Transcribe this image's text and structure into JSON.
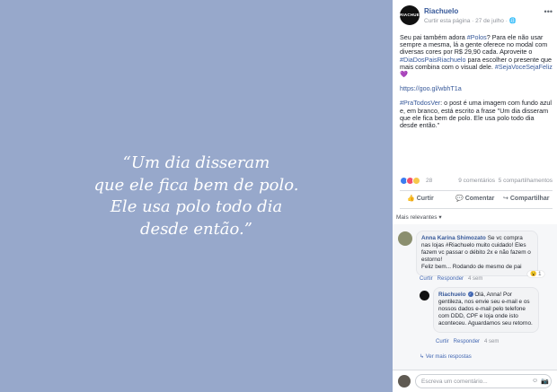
{
  "image": {
    "quote_lines": [
      "“Um dia disseram",
      "que ele fica bem de polo.",
      "Ele usa polo todo dia",
      "desde então.”"
    ]
  },
  "post": {
    "page_logo_text": "RIACHUELO",
    "page_name": "Riachuelo",
    "subline_follow": "Curtir esta página",
    "subline_date": "27 de julho",
    "audience_icon": "globe-icon",
    "more_icon": "more-dots-icon",
    "text_p1_a": "Seu pai também adora ",
    "text_p1_tag1": "#Polos",
    "text_p1_b": "? Para ele não usar sempre a mesma, lá a gente oferece no modal com diversas cores por R$ 29,90 cada. Aproveite o ",
    "text_p1_tag2": "#DiaDosPaisRiachuelo",
    "text_p1_c": " para escolher o presente que mais combina com o visual dele. ",
    "text_p1_tag3": "#SejaVoceSejaFeliz",
    "text_p1_heart": " 💜",
    "text_link": "https://goo.gl/wbhT1a",
    "text_p3_tag": "#PraTodosVer",
    "text_p3": ": o post é uma imagem com fundo azul e, em branco, está escrito a frase \"Um dia disseram que ele fica bem de polo. Ele usa polo todo dia desde então.\""
  },
  "stats": {
    "reaction_count": "28",
    "comment_count": "9 comentários",
    "share_count": "5 compartilhamentos"
  },
  "actions": {
    "like_label": "Curtir",
    "comment_label": "Comentar",
    "share_label": "Compartilhar"
  },
  "filter_label": "Mais relevantes ▾",
  "comments": [
    {
      "author": "Anna Karina Shimozato",
      "text": "Se vc compra nas lojas #Riachuelo muito cuidado! Eles fazem vc passar o débito 2x e não fazem o estorno!",
      "extra": "Feliz bem... Rodando de mesmo de pai",
      "actions": [
        "Curtir",
        "Responder",
        "4 sem"
      ],
      "reaction_count": "1"
    },
    {
      "author": "Riachuelo",
      "text": "Olá, Anna! Por gentileza, nos envie seu e-mail e os nossos dados e-mail pelo telefone com DDD, CPF e loja onde isto aconteceu. Aguardamos seu retorno.",
      "actions": [
        "Curtir",
        "Responder",
        "4 sem"
      ]
    }
  ],
  "more_replies": "Ver mais respostas",
  "composer": {
    "placeholder": "Escreva um comentário..."
  }
}
